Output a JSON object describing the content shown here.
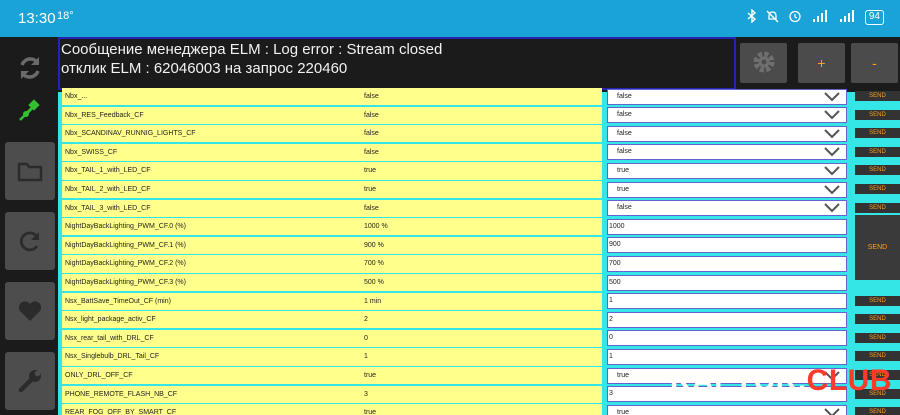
{
  "status_bar": {
    "time": "13:30",
    "temperature": "18°",
    "battery": "94",
    "bar_color": "#1aa3d6"
  },
  "message": {
    "line1": "Сообщение менеджера ELM : Log error : Stream closed",
    "line2": "отклик ELM : 62046003 на запрос 220460"
  },
  "header_buttons": {
    "settings_icon": "gear-icon",
    "plus_label": "+",
    "minus_label": "-"
  },
  "left_toolbar": {
    "icons": [
      "refresh-arrows-icon",
      "plug-icon",
      "folder-icon",
      "reload-icon",
      "heart-icon",
      "wrench-icon"
    ]
  },
  "table": {
    "send_label": "SEND",
    "rows": [
      {
        "name": "Nbx_...",
        "value": "false",
        "control": "select",
        "current": "false"
      },
      {
        "name": "Nbx_RES_Feedback_CF",
        "value": "false",
        "control": "select",
        "current": "false"
      },
      {
        "name": "Nbx_SCANDINAV_RUNNIG_LIGHTS_CF",
        "value": "false",
        "control": "select",
        "current": "false"
      },
      {
        "name": "Nbx_SWISS_CF",
        "value": "false",
        "control": "select",
        "current": "false"
      },
      {
        "name": "Nbx_TAIL_1_with_LED_CF",
        "value": "true",
        "control": "select",
        "current": "true"
      },
      {
        "name": "Nbx_TAIL_2_with_LED_CF",
        "value": "true",
        "control": "select",
        "current": "true"
      },
      {
        "name": "Nbx_TAIL_3_with_LED_CF",
        "value": "false",
        "control": "select",
        "current": "false"
      },
      {
        "name": "NightDayBackLighting_PWM_CF.0 (%)",
        "value": "1000 %",
        "control": "input",
        "current": "1000"
      },
      {
        "name": "NightDayBackLighting_PWM_CF.1 (%)",
        "value": "900 %",
        "control": "input",
        "current": "900"
      },
      {
        "name": "NightDayBackLighting_PWM_CF.2 (%)",
        "value": "700 %",
        "control": "input",
        "current": "700"
      },
      {
        "name": "NightDayBackLighting_PWM_CF.3 (%)",
        "value": "500 %",
        "control": "input",
        "current": "500"
      },
      {
        "name": "Nsx_BattSave_TimeOut_CF (min)",
        "value": "1 min",
        "control": "input",
        "current": "1"
      },
      {
        "name": "Nsx_light_package_activ_CF",
        "value": "2",
        "control": "input",
        "current": "2"
      },
      {
        "name": "Nsx_rear_tail_with_DRL_CF",
        "value": "0",
        "control": "input",
        "current": "0"
      },
      {
        "name": "Nsx_Singlebulb_DRL_Tail_CF",
        "value": "1",
        "control": "input",
        "current": "1"
      },
      {
        "name": "ONLY_DRL_OFF_CF",
        "value": "true",
        "control": "select",
        "current": "true"
      },
      {
        "name": "PHONE_REMOTE_FLASH_NB_CF",
        "value": "3",
        "control": "input",
        "current": "3"
      },
      {
        "name": "REAR_FOG_OFF_BY_SMART_CF",
        "value": "true",
        "control": "select",
        "current": "true"
      }
    ]
  },
  "watermark": {
    "part1": "KAPTUR.",
    "part2": "CLUB"
  }
}
